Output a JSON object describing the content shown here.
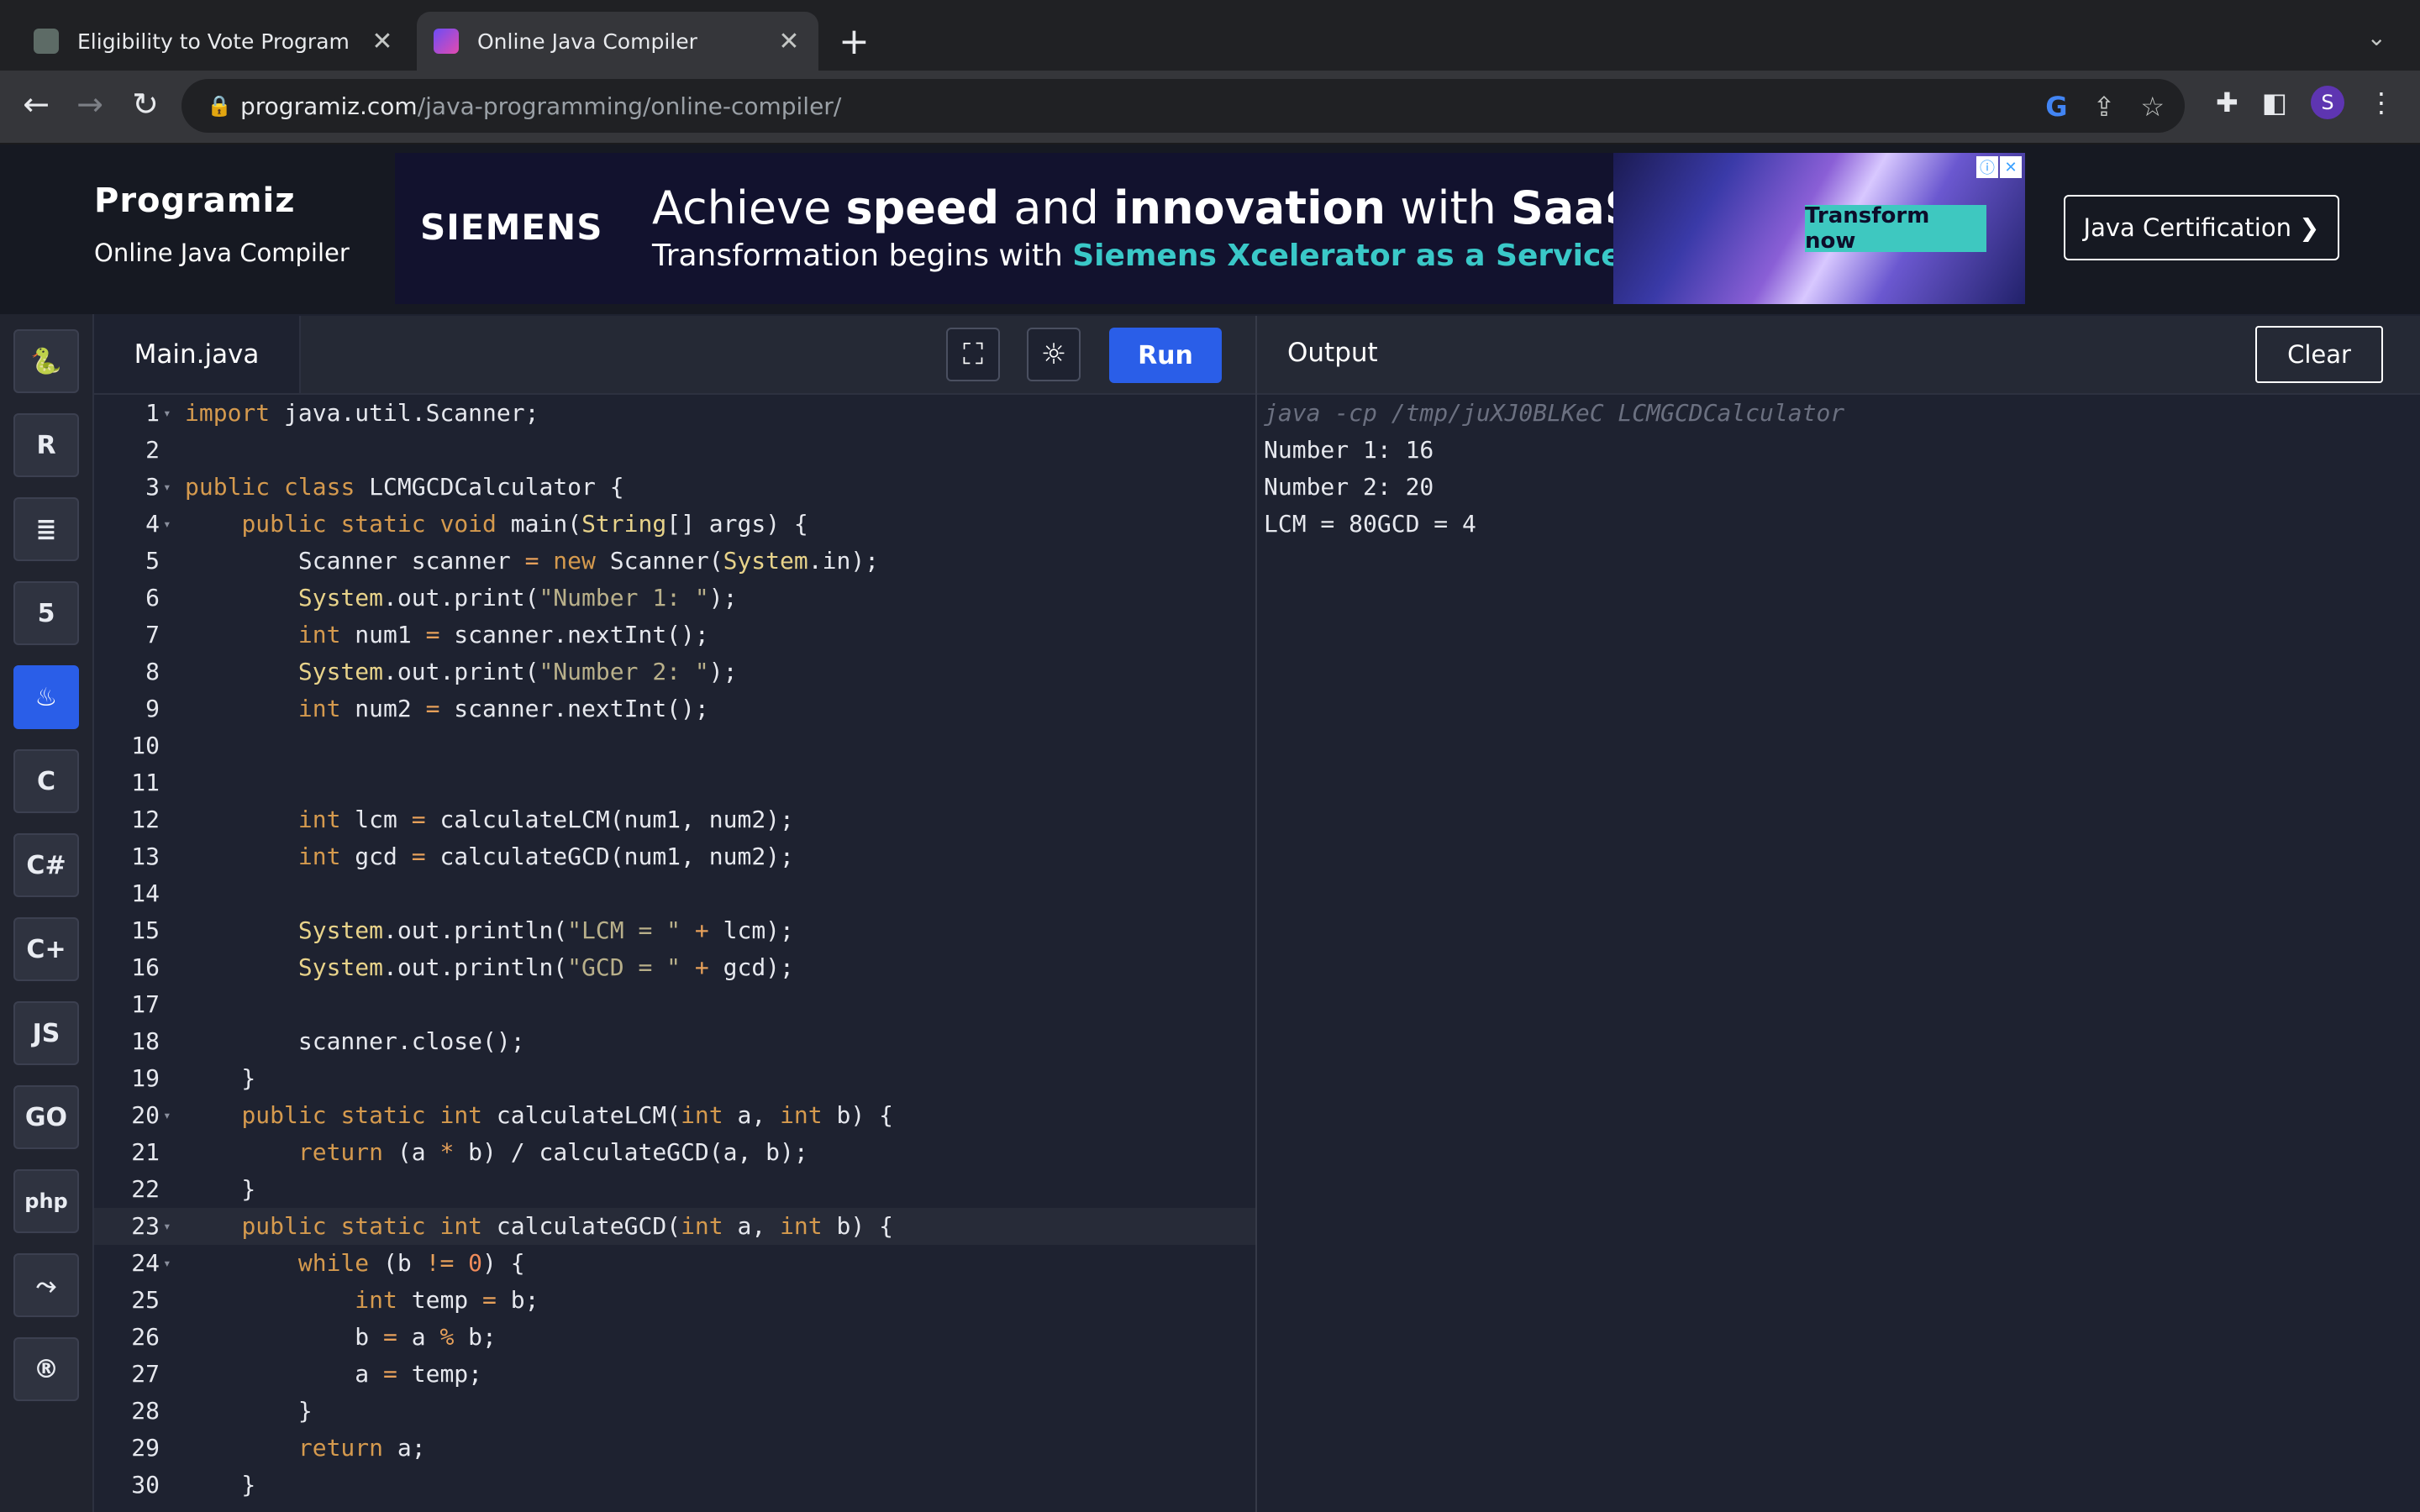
{
  "browser": {
    "tabs": [
      {
        "title": "Eligibility to Vote Program",
        "active": false
      },
      {
        "title": "Online Java Compiler",
        "active": true
      }
    ],
    "url_host": "programiz.com",
    "url_path": "/java-programming/online-compiler/",
    "profile_initial": "S"
  },
  "site": {
    "logo": "Programiz",
    "subtitle": "Online Java Compiler",
    "certification_button": "Java Certification ❯"
  },
  "ad": {
    "brand": "SIEMENS",
    "headline_pre": "Achieve ",
    "headline_b1": "speed",
    "headline_mid": " and ",
    "headline_b2": "innovation",
    "headline_post": " with ",
    "headline_b3": "SaaS",
    "sub_pre": "Transformation begins with ",
    "sub_highlight": "Siemens Xcelerator as a Service",
    "cta": "Transform now"
  },
  "languages": [
    {
      "name": "python-icon",
      "glyph": "🐍"
    },
    {
      "name": "r-icon",
      "glyph": "R"
    },
    {
      "name": "sql-icon",
      "glyph": "≣"
    },
    {
      "name": "html-icon",
      "glyph": "5"
    },
    {
      "name": "java-icon",
      "glyph": "♨"
    },
    {
      "name": "c-icon",
      "glyph": "C"
    },
    {
      "name": "csharp-icon",
      "glyph": "C#"
    },
    {
      "name": "cpp-icon",
      "glyph": "C+"
    },
    {
      "name": "javascript-icon",
      "glyph": "JS"
    },
    {
      "name": "go-icon",
      "glyph": "GO"
    },
    {
      "name": "php-icon",
      "glyph": "php"
    },
    {
      "name": "swift-icon",
      "glyph": "⤳"
    },
    {
      "name": "rust-icon",
      "glyph": "®"
    }
  ],
  "active_language": "java-icon",
  "editor": {
    "file_tab": "Main.java",
    "run_label": "Run",
    "fullscreen_icon": "fullscreen-icon",
    "theme_icon": "sun-icon"
  },
  "code": [
    {
      "n": "1",
      "fold": true,
      "t": "import java.util.Scanner;"
    },
    {
      "n": "2",
      "fold": false,
      "t": ""
    },
    {
      "n": "3",
      "fold": true,
      "t": "public class LCMGCDCalculator {"
    },
    {
      "n": "4",
      "fold": true,
      "t": "    public static void main(String[] args) {"
    },
    {
      "n": "5",
      "fold": false,
      "t": "        Scanner scanner = new Scanner(System.in);"
    },
    {
      "n": "6",
      "fold": false,
      "t": "        System.out.print(\"Number 1: \");"
    },
    {
      "n": "7",
      "fold": false,
      "t": "        int num1 = scanner.nextInt();"
    },
    {
      "n": "8",
      "fold": false,
      "t": "        System.out.print(\"Number 2: \");"
    },
    {
      "n": "9",
      "fold": false,
      "t": "        int num2 = scanner.nextInt();"
    },
    {
      "n": "10",
      "fold": false,
      "t": ""
    },
    {
      "n": "11",
      "fold": false,
      "t": ""
    },
    {
      "n": "12",
      "fold": false,
      "t": "        int lcm = calculateLCM(num1, num2);"
    },
    {
      "n": "13",
      "fold": false,
      "t": "        int gcd = calculateGCD(num1, num2);"
    },
    {
      "n": "14",
      "fold": false,
      "t": ""
    },
    {
      "n": "15",
      "fold": false,
      "t": "        System.out.println(\"LCM = \" + lcm);"
    },
    {
      "n": "16",
      "fold": false,
      "t": "        System.out.println(\"GCD = \" + gcd);"
    },
    {
      "n": "17",
      "fold": false,
      "t": ""
    },
    {
      "n": "18",
      "fold": false,
      "t": "        scanner.close();"
    },
    {
      "n": "19",
      "fold": false,
      "t": "    }"
    },
    {
      "n": "20",
      "fold": true,
      "t": "    public static int calculateLCM(int a, int b) {"
    },
    {
      "n": "21",
      "fold": false,
      "t": "        return (a * b) / calculateGCD(a, b);"
    },
    {
      "n": "22",
      "fold": false,
      "t": "    }"
    },
    {
      "n": "23",
      "fold": true,
      "t": "    public static int calculateGCD(int a, int b) {"
    },
    {
      "n": "24",
      "fold": true,
      "t": "        while (b != 0) {"
    },
    {
      "n": "25",
      "fold": false,
      "t": "            int temp = b;"
    },
    {
      "n": "26",
      "fold": false,
      "t": "            b = a % b;"
    },
    {
      "n": "27",
      "fold": false,
      "t": "            a = temp;"
    },
    {
      "n": "28",
      "fold": false,
      "t": "        }"
    },
    {
      "n": "29",
      "fold": false,
      "t": "        return a;"
    },
    {
      "n": "30",
      "fold": false,
      "t": "    }"
    }
  ],
  "highlighted_line": "23",
  "output": {
    "title": "Output",
    "clear_label": "Clear",
    "lines": [
      "java -cp /tmp/juXJ0BLKeC LCMGCDCalculator",
      "Number 1: 16",
      "Number 2: 20",
      "LCM = 80GCD = 4"
    ]
  }
}
